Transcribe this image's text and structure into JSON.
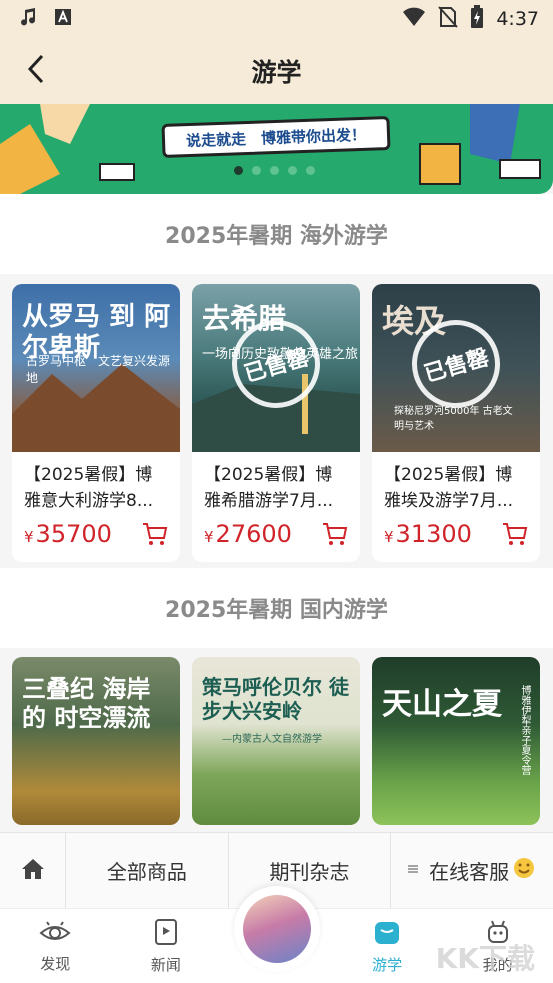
{
  "status_bar": {
    "time": "4:37",
    "icons": [
      "music-note-icon",
      "font-a-icon",
      "wifi-icon",
      "no-sim-icon",
      "battery-charging-icon"
    ]
  },
  "header": {
    "title": "游学",
    "back_icon": "chevron-left-icon"
  },
  "banner": {
    "slogan": "说走就走　博雅带你出发！",
    "dots": 5,
    "active_dot": 0
  },
  "sections": [
    {
      "title": "2025年暑期 海外游学",
      "items": [
        {
          "image_title": "从罗马 到 阿尔卑斯",
          "image_subtitle": "古罗马中枢　文艺复兴发源地",
          "badge": "",
          "title": "【2025暑假】博雅意大利游学8...",
          "price": "35700"
        },
        {
          "image_title": "去希腊",
          "image_subtitle": "一场向历史致敬的英雄之旅",
          "badge": "已售罄",
          "title": "【2025暑假】博雅希腊游学7月...",
          "price": "27600"
        },
        {
          "image_title": "埃及",
          "image_subtitle": "探秘尼罗河5000年 古老文明与艺术",
          "badge": "已售罄",
          "title": "【2025暑假】博雅埃及游学7月...",
          "price": "31300"
        }
      ]
    },
    {
      "title": "2025年暑期 国内游学",
      "items": [
        {
          "image_title": "三叠纪 海岸的 时空漂流",
          "image_subtitle": ""
        },
        {
          "image_title": "策马呼伦贝尔 徒步大兴安岭",
          "image_subtitle": "—内蒙古人文自然游学"
        },
        {
          "image_title": "天山之夏",
          "image_subtitle": "博雅伊犁亲子夏令营"
        }
      ]
    }
  ],
  "currency": "¥",
  "bottom_menu": {
    "home_icon": "home-icon",
    "items": [
      "全部商品",
      "期刊杂志",
      "在线客服"
    ],
    "grip_icon": "menu-grip-icon",
    "emoji_icon": "smiling-emoji-icon"
  },
  "tabs": [
    {
      "label": "发现",
      "icon": "eye-icon"
    },
    {
      "label": "新闻",
      "icon": "play-book-icon"
    },
    {
      "label": "",
      "icon": "avatar"
    },
    {
      "label": "游学",
      "icon": "bag-icon"
    },
    {
      "label": "我的",
      "icon": "robot-icon"
    }
  ],
  "watermark": "KK下载",
  "colors": {
    "header_bg": "#f6ebd9",
    "banner_green": "#26a96d",
    "price_red": "#d0242a",
    "active_tab": "#2bb0d0",
    "section_title": "#8a8a8a"
  }
}
